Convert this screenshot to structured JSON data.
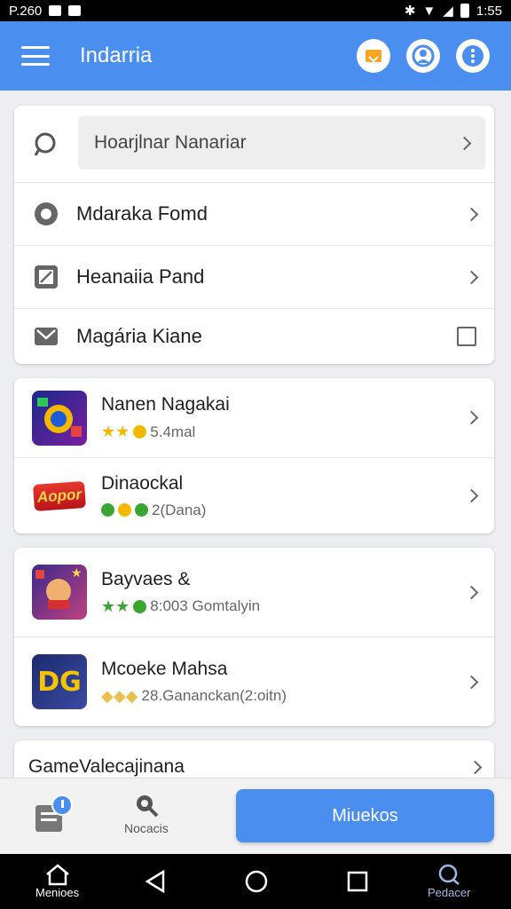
{
  "status_bar": {
    "left": "P.260",
    "time": "1:55"
  },
  "app_bar": {
    "title": "Indarria"
  },
  "menu_card": {
    "search_text": "Hoarjlnar Nanariar",
    "items": [
      {
        "label": "Mdaraka Fomd"
      },
      {
        "label": "Heanaiia Pand"
      },
      {
        "label": "Magária Kiane"
      }
    ]
  },
  "games_card_1": [
    {
      "name": "Nanen Nagakai",
      "meta": "5.4mal",
      "icon_text": ""
    },
    {
      "name": "Dinaockal",
      "meta": "2(Dana)",
      "icon_text": "Aopor"
    }
  ],
  "games_card_2": [
    {
      "name": "Bayvaes &",
      "meta": "8:003 Gomtalyin",
      "icon_text": ""
    },
    {
      "name": "Mcoeke Mahsa",
      "meta": "28.Gananckan(2:oitn)",
      "icon_text": "DG"
    }
  ],
  "partial_card": {
    "title": "GameValecajinana"
  },
  "bottom_bar": {
    "notes_label": "Nocacis",
    "primary_button": "Miuekos"
  },
  "nav_bar": {
    "home_label": "Menioes",
    "profile_label": "Pedacer"
  },
  "colors": {
    "accent": "#4a8ff0",
    "star": "#f5b800",
    "green": "#3ba532"
  }
}
